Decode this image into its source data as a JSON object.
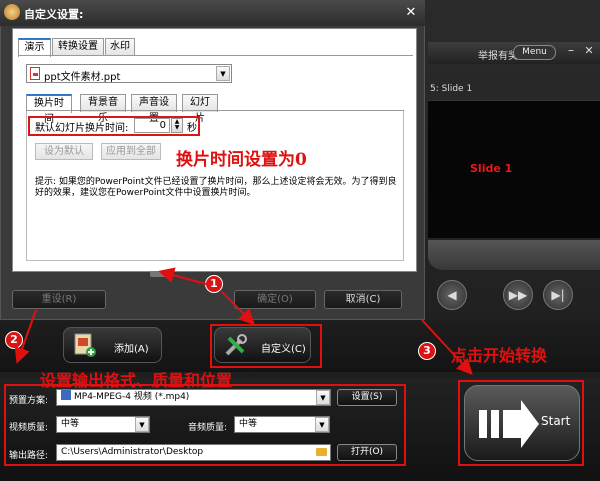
{
  "dialog": {
    "title": "自定义设置:",
    "tabs": [
      "演示",
      "转换设置",
      "水印"
    ],
    "file_select": "ppt文件素材.ppt",
    "sub_tabs": [
      "换片时间",
      "背景音乐",
      "声音设置",
      "幻灯片"
    ],
    "timing_label": "默认幻灯片换片时间:",
    "timing_value": "0",
    "timing_unit": "秒",
    "set_default": "设为默认",
    "apply_all": "应用到全部",
    "tip": "提示: 如果您的PowerPoint文件已经设置了换片时间，那么上述设定将会无效。为了得到良好的效果，建议您在PowerPoint文件中设置换片时间。",
    "reset": "重设(R)",
    "ok": "确定(O)",
    "cancel": "取消(C)"
  },
  "app": {
    "report": "举报有奖",
    "menu": "Menu",
    "preview_head": "5: Slide 1",
    "slide_label": "Slide 1",
    "add": "添加(A)",
    "customize": "自定义(C)",
    "preset_label": "预置方案:",
    "preset_value": "MP4-MPEG-4 视频 (*.mp4)",
    "settings": "设置(S)",
    "video_quality_label": "视频质量:",
    "video_quality": "中等",
    "audio_quality_label": "音频质量:",
    "audio_quality": "中等",
    "output_label": "输出路径:",
    "output_path": "C:\\Users\\Administrator\\Desktop",
    "open": "打开(O)",
    "start": "Start"
  },
  "annotations": {
    "note_time": "换片时间设置为0",
    "note_format": "设置输出格式、质量和位置",
    "note_start": "点击开始转换",
    "n1": "1",
    "n2": "2",
    "n3": "3"
  },
  "colors": {
    "annotation": "#e01010",
    "tab_accent": "#3377cc"
  }
}
